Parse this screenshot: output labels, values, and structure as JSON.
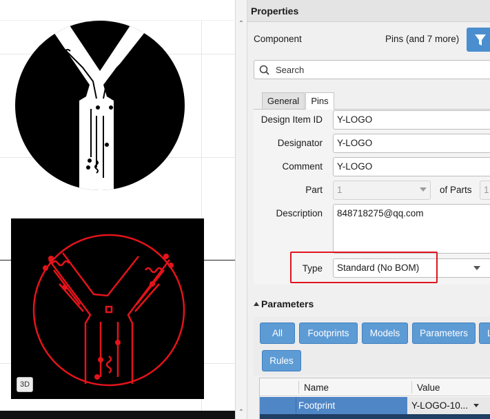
{
  "panel": {
    "title": "Properties",
    "component_label": "Component",
    "pins_filter_label": "Pins (and 7 more)",
    "search_placeholder": "Search"
  },
  "tabs": [
    {
      "label": "General"
    },
    {
      "label": "Pins"
    }
  ],
  "fields": {
    "design_item_id": {
      "label": "Design Item ID",
      "value": "Y-LOGO"
    },
    "designator": {
      "label": "Designator",
      "value": "Y-LOGO"
    },
    "comment": {
      "label": "Comment",
      "value": "Y-LOGO"
    },
    "part": {
      "label": "Part",
      "value": "1"
    },
    "of_parts": {
      "label": "of Parts",
      "value": "1"
    },
    "description": {
      "label": "Description",
      "value": "848718275@qq.com"
    },
    "type": {
      "label": "Type",
      "value": "Standard (No BOM)"
    }
  },
  "parameters": {
    "header": "Parameters",
    "buttons": [
      "All",
      "Footprints",
      "Models",
      "Parameters",
      "L",
      "Rules"
    ],
    "table": {
      "columns": [
        "Name",
        "Value"
      ],
      "rows": [
        {
          "name": "Footprint",
          "value": "Y-LOGO-10..."
        }
      ]
    }
  },
  "canvas": {
    "badge_3d": "3D"
  },
  "colors": {
    "accent": "#5d9bd5",
    "highlight": "#e0141e",
    "trace_red": "#e4131b",
    "row_selected": "#4f86c6"
  }
}
